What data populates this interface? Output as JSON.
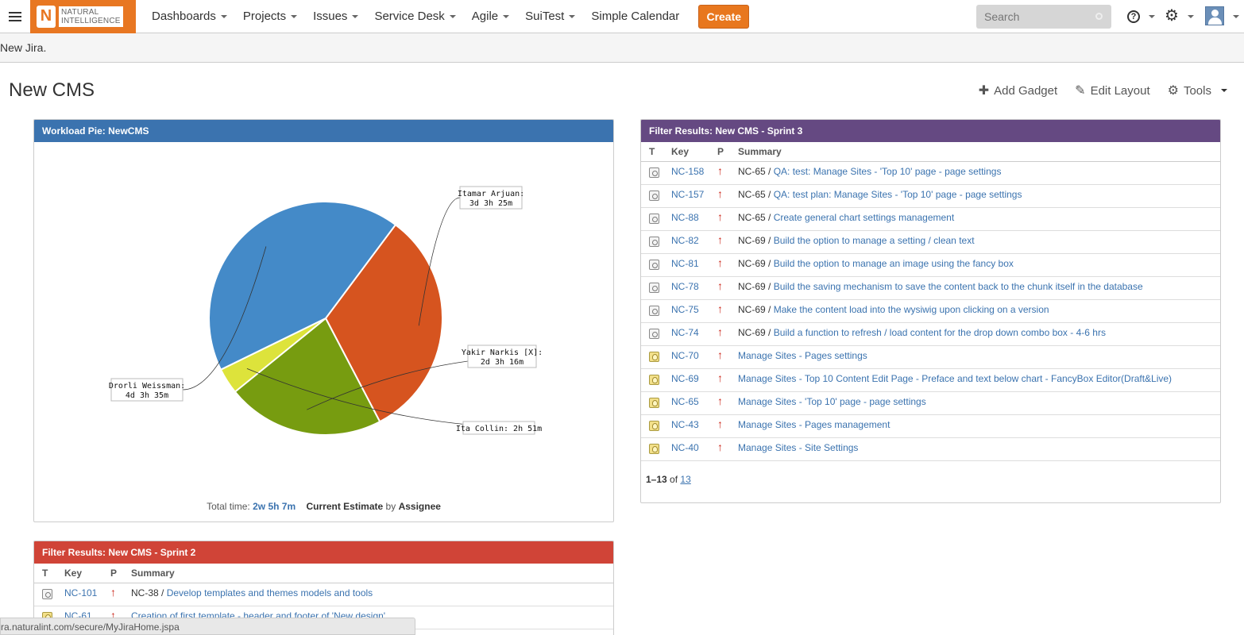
{
  "nav": {
    "logo_letter": "N",
    "logo_line1": "NATURAL",
    "logo_line2": "INTELLIGENCE",
    "menu": [
      "Dashboards",
      "Projects",
      "Issues",
      "Service Desk",
      "Agile",
      "SuiTest",
      "Simple Calendar"
    ],
    "create_label": "Create",
    "search_placeholder": "Search"
  },
  "banner": {
    "text": "New Jira."
  },
  "dashboard": {
    "title": "New CMS",
    "add_gadget": "Add Gadget",
    "edit_layout": "Edit Layout",
    "tools": "Tools"
  },
  "pie_gadget": {
    "title": "Workload Pie: NewCMS",
    "total_label": "Total time:",
    "total_value": "2w 5h 7m",
    "field": "Current Estimate",
    "by": "by",
    "group": "Assignee"
  },
  "chart_data": {
    "type": "pie",
    "categories": [
      "Itamar Arjuan",
      "Yakir Narkis [X]",
      "Ita Collin",
      "Drorli Weissman"
    ],
    "labels": [
      [
        "Itamar Arjuan:",
        "3d 3h 25m"
      ],
      [
        "Yakir Narkis [X]:",
        "2d 3h 16m"
      ],
      [
        "Ita Collin: 2h 51m"
      ],
      [
        "Drorli Weissman:",
        "4d 3h 35m"
      ]
    ],
    "values": [
      1525,
      1036,
      171,
      2015
    ],
    "colors": [
      "#d6541f",
      "#779c10",
      "#dde33b",
      "#448ac8"
    ],
    "title": ""
  },
  "sprint3": {
    "title": "Filter Results: New CMS - Sprint 3",
    "headers": [
      "T",
      "Key",
      "P",
      "Summary"
    ],
    "rows": [
      {
        "type": "task",
        "key": "NC-158",
        "parent": "NC-65",
        "summary": "QA: test: Manage Sites - 'Top 10' page - page settings"
      },
      {
        "type": "task",
        "key": "NC-157",
        "parent": "NC-65",
        "summary": "QA: test plan: Manage Sites - 'Top 10' page - page settings"
      },
      {
        "type": "task",
        "key": "NC-88",
        "parent": "NC-65",
        "summary": "Create general chart settings management"
      },
      {
        "type": "task",
        "key": "NC-82",
        "parent": "NC-69",
        "summary": "Build the option to manage a setting / clean text"
      },
      {
        "type": "task",
        "key": "NC-81",
        "parent": "NC-69",
        "summary": "Build the option to manage an image using the fancy box"
      },
      {
        "type": "task",
        "key": "NC-78",
        "parent": "NC-69",
        "summary": "Build the saving mechanism to save the content back to the chunk itself in the database"
      },
      {
        "type": "task",
        "key": "NC-75",
        "parent": "NC-69",
        "summary": "Make the content load into the wysiwig upon clicking on a version"
      },
      {
        "type": "task",
        "key": "NC-74",
        "parent": "NC-69",
        "summary": "Build a function to refresh / load content for the drop down combo box - 4-6 hrs"
      },
      {
        "type": "story",
        "key": "NC-70",
        "parent": "",
        "summary": "Manage Sites - Pages settings"
      },
      {
        "type": "story",
        "key": "NC-69",
        "parent": "",
        "summary": "Manage Sites - Top 10 Content Edit Page - Preface and text below chart - FancyBox Editor(Draft&Live)"
      },
      {
        "type": "story",
        "key": "NC-65",
        "parent": "",
        "summary": "Manage Sites - 'Top 10' page - page settings"
      },
      {
        "type": "story",
        "key": "NC-43",
        "parent": "",
        "summary": "Manage Sites - Pages management"
      },
      {
        "type": "story",
        "key": "NC-40",
        "parent": "",
        "summary": "Manage Sites - Site Settings"
      }
    ],
    "paging_range": "1–13",
    "paging_of": "of",
    "paging_total": "13"
  },
  "sprint2": {
    "title": "Filter Results: New CMS - Sprint 2",
    "headers": [
      "T",
      "Key",
      "P",
      "Summary"
    ],
    "rows": [
      {
        "type": "task",
        "key": "NC-101",
        "parent": "NC-38",
        "summary": "Develop templates and themes models and tools"
      },
      {
        "type": "story",
        "key": "NC-61",
        "parent": "",
        "summary": "Creation of first template - header and footer of 'New design'"
      }
    ]
  },
  "statusbar": {
    "url": "ra.naturalint.com/secure/MyJiraHome.jspa"
  },
  "icons": {
    "menu": "hamburger-icon",
    "help": "help-icon",
    "settings": "gear-icon",
    "add": "plus-icon",
    "edit": "pencil-icon",
    "tools": "gear-icon",
    "priority": "arrow-up-icon",
    "task": "task-icon",
    "story": "story-icon"
  }
}
